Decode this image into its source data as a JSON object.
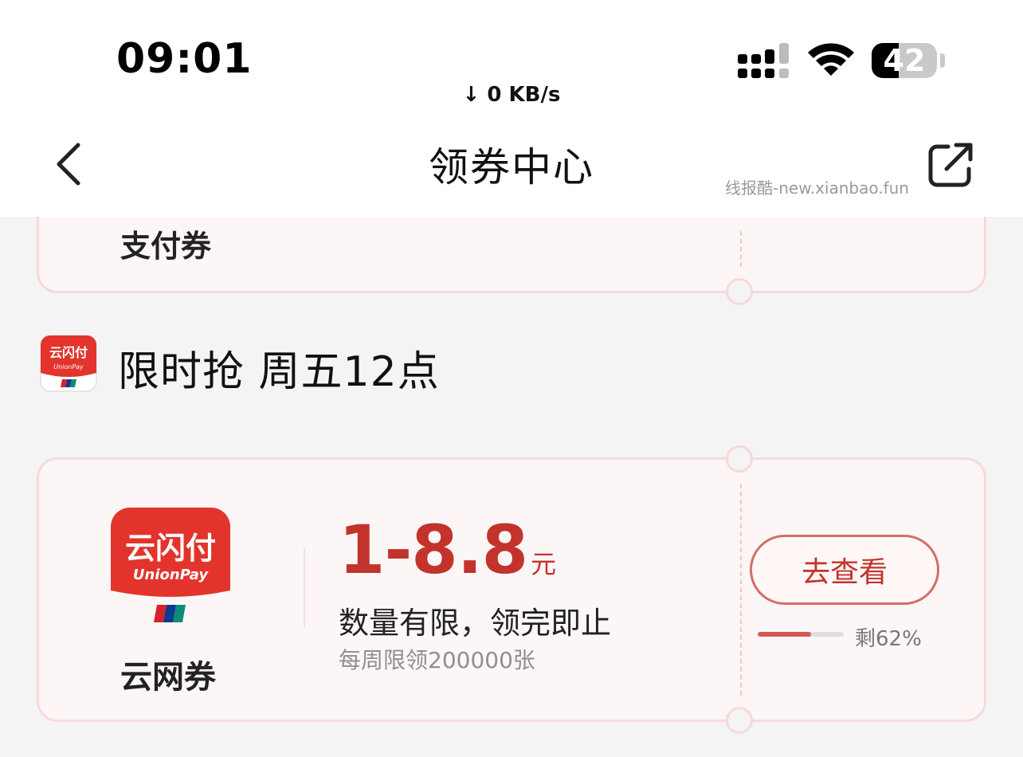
{
  "status_bar": {
    "time": "09:01",
    "network_speed": "↓ 0 KB/s",
    "battery_level": "42",
    "battery_fraction": 0.42,
    "icons": [
      "signal-icon",
      "wifi-icon",
      "battery-icon"
    ]
  },
  "nav": {
    "title": "领券中心",
    "back_icon": "chevron-left-icon",
    "share_icon": "share-icon"
  },
  "watermark": "线报酷-new.xianbao.fun",
  "top_coupon": {
    "name": "支付券"
  },
  "section": {
    "logo_icon": "unionpay-logo-icon",
    "title": "限时抢 周五12点"
  },
  "coupon": {
    "logo_icon": "unionpay-logo-icon",
    "name": "云网券",
    "amount": "1-8.8",
    "unit": "元",
    "description": "数量有限，领完即止",
    "limit": "每周限领200000张",
    "button_label": "去查看",
    "remaining_label": "剩62%",
    "remaining_fraction": 0.62
  },
  "colors": {
    "accent": "#c2332b",
    "coupon_bg": "#fdf6f6",
    "coupon_border": "#f8d9d9",
    "page_bg": "#f4f4f4"
  }
}
